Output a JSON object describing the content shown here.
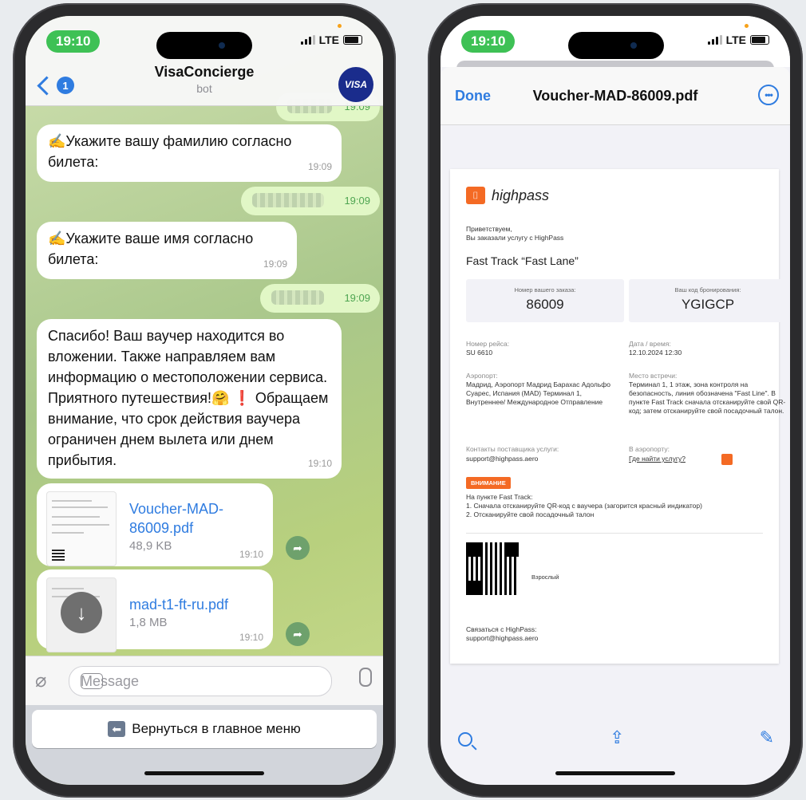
{
  "status": {
    "time": "19:10",
    "network": "LTE"
  },
  "telegram": {
    "back_badge": "1",
    "title": "VisaConcierge",
    "subtitle": "bot",
    "avatar": "VISA",
    "messages": [
      {
        "text": "✍️Укажите вашу фамилию согласно билета:",
        "time": "19:09"
      },
      {
        "text": "✍️Укажите ваше имя согласно билета:",
        "time": "19:09"
      },
      {
        "text": "Спасибо! Ваш ваучер находится во вложении. Также направляем вам информацию о местоположении сервиса. Приятного путешествия!🤗 ❗ Обращаем внимание, что срок действия ваучера ограничен днем вылета или днем прибытия.",
        "time": "19:10"
      }
    ],
    "outgoing": [
      {
        "time": "19:09"
      },
      {
        "time": "19:09"
      },
      {
        "time": "19:09"
      }
    ],
    "files": [
      {
        "name": "Voucher-MAD-86009.pdf",
        "size": "48,9 KB",
        "time": "19:10"
      },
      {
        "name": "mad-t1-ft-ru.pdf",
        "size": "1,8 MB",
        "time": "19:10"
      }
    ],
    "input_placeholder": "Message",
    "keyboard_button": "Вернуться в главное меню"
  },
  "pdf": {
    "done": "Done",
    "title": "Voucher-MAD-86009.pdf",
    "brand": "highpass",
    "greeting": "Приветствуем,",
    "greeting2": "Вы заказали услугу с HighPass",
    "service": "Fast Track “Fast Lane”",
    "order_label": "Номер вашего заказа:",
    "order_value": "86009",
    "booking_label": "Ваш код бронирования:",
    "booking_value": "YGIGCP",
    "flight_label": "Номер рейса:",
    "flight_value": "SU 6610",
    "date_label": "Дата / время:",
    "date_value": "12.10.2024 12:30",
    "airport_label": "Аэропорт:",
    "airport_value": "Мадрид, Аэропорт Мадрид Барахас Адольфо Суарес, Испания (MAD) Терминал 1, Внутреннее/ Международное Отправление",
    "meeting_label": "Место встречи:",
    "meeting_value": "Терминал 1, 1 этаж, зона контроля на безопасность, линия обозначена \"Fast Line\". В пункте Fast Track сначала отсканируйте свой QR-код; затем отсканируйте свой посадочный талон.",
    "contacts_label": "Контакты поставщика услуги:",
    "contacts_value": "support@highpass.aero",
    "in_airport_label": "В аэропорту:",
    "in_airport_value": "Где найти услугу?",
    "warning": "ВНИМАНИЕ",
    "instructions_title": "На пункте Fast Track:",
    "instruction1": "1. Сначала отсканируйте QR-код с ваучера (загорится красный индикатор)",
    "instruction2": "2. Отсканируйте свой посадочный талон",
    "passenger_type": "Взрослый",
    "contact_footer1": "Связаться с HighPass:",
    "contact_footer2": "support@highpass.aero"
  }
}
